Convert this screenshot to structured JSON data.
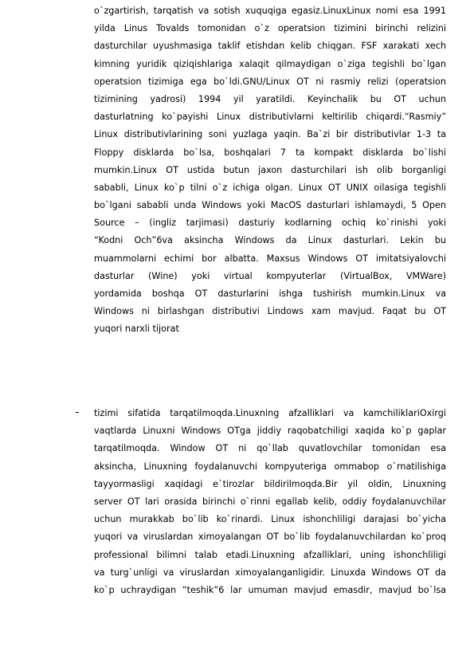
{
  "document": {
    "paragraph1": {
      "lines": [
        "o`zgartirish, tarqatish va sotish xuquqiga egasiz.LinuxLinux nomi esa 1991",
        "yilda Linus Tovalds tomonidan o`z operatsion tizimini birinchi relizini",
        "dasturchilar uyushmasiga taklif etishdan kelib chiqgan. FSF xarakati xech",
        "kimning yuridik qiziqishlariga xalaqit qilmaydigan o`ziga tegishli bo`lgan",
        "operatsion tizimiga ega bo`ldi.GNU/Linux OT ni rasmiy relizi (operatsion",
        "tizimining yadrosi) 1994 yil yaratildi. Keyinchalik bu OT uchun",
        "dasturlatning ko`payishi Linux distributivlarni keltirilib chiqardi.“Rasmiy”",
        "Linux distributivlarining soni yuzlaga yaqin. Ba`zi bir distributivlar 1-3 ta",
        "Floppy disklarda bo`lsa, boshqalari 7 ta kompakt disklarda bo`lishi",
        "mumkin.Linux OT ustida butun jaxon dasturchilari ish olib borganligi",
        "sababli, Linux ko`p tilni o`z ichiga olgan. Linux OT UNIX oilasiga tegishli",
        "bo`lgani sababli unda Windows yoki MacOS dasturlari ishlamaydi, 5 Open",
        "Source – (ingliz tarjimasi) dasturiy kodlarning ochiq ko`rinishi yoki",
        "“Kodni Och”6va aksincha Windows da Linux dasturlari. Lekin bu",
        "muammolarni echimi bor albatta. Maxsus Windows OT imitatsiyalovchi",
        "dasturlar (Wine) yoki virtual kompyuterlar (VirtualBox, VMWare)",
        "yordamida boshqa OT dasturlarini ishga tushirish mumkin.Linux va",
        "Windows ni birlashgan distributivi Lindows xam mavjud. Faqat bu OT",
        "yuqori narxli tijorat"
      ]
    },
    "paragraph2": {
      "bullet": "–",
      "lines": [
        "tizimi sifatida tarqatilmoqda.Linuxning afzalliklari va kamchiliklariOxirgi",
        "vaqtlarda Linuxni Windows OTga jiddiy raqobatchiligi xaqida ko`p gaplar",
        "tarqatilmoqda. Window OT ni qo`llab quvatlovchilar tomonidan esa",
        "aksincha, Linuxning foydalanuvchi kompyuteriga ommabop o`rnatilishiga",
        "tayyormasligi xaqidagi e`tirozlar bildirilmoqda.Bir yil oldin, Linuxning",
        "server OT lari orasida birinchi o`rinni egallab kelib, oddiy foydalanuvchilar",
        "uchun murakkab bo`lib ko`rinardi. Linux ishonchliligi darajasi bo`yicha",
        "yuqori va viruslardan ximoyalangan OT bo`lib foydalanuvchilardan ko`proq",
        "professional bilimni talab etadi.Linuxning afzalliklari, uning ishonchliligi",
        "va turg`unligi va viruslardan ximoyalanganligidir. Linuxda Windows OT da",
        "ko`p uchraydigan “teshik”6 lar umuman mavjud emasdir, mavjud bo`lsa"
      ]
    }
  }
}
